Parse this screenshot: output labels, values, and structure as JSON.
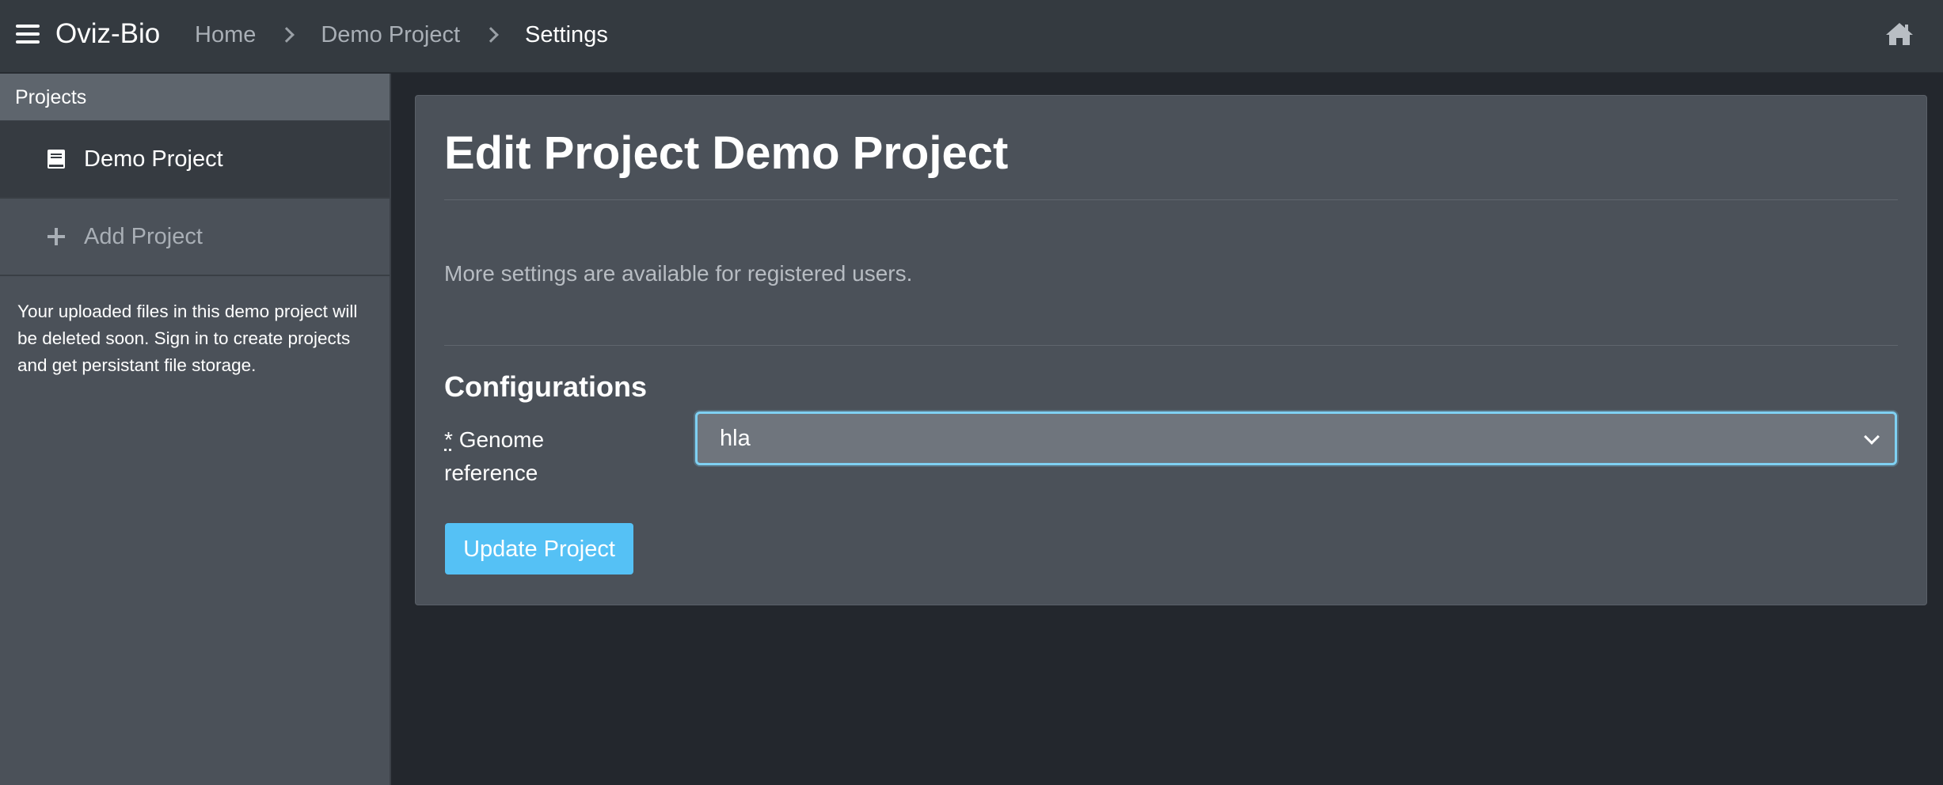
{
  "topbar": {
    "brand": "Oviz-Bio",
    "breadcrumb": [
      "Home",
      "Demo Project",
      "Settings"
    ]
  },
  "sidebar": {
    "header": "Projects",
    "items": [
      {
        "label": "Demo Project",
        "icon": "book-icon",
        "active": true
      },
      {
        "label": "Add Project",
        "icon": "plus-icon",
        "active": false
      }
    ],
    "note": "Your uploaded files in this demo project will be deleted soon. Sign in to create projects and get persistant file storage."
  },
  "main": {
    "title": "Edit Project Demo Project",
    "info": "More settings are available for registered users.",
    "section_title": "Configurations",
    "field": {
      "required_mark": "*",
      "label": "Genome reference",
      "value": "hla"
    },
    "submit_label": "Update Project"
  },
  "colors": {
    "topbar": "#343a40",
    "sidebar": "#4b5159",
    "background": "#23272d",
    "accent": "#55c1f5",
    "focus": "#7fd0f2"
  }
}
